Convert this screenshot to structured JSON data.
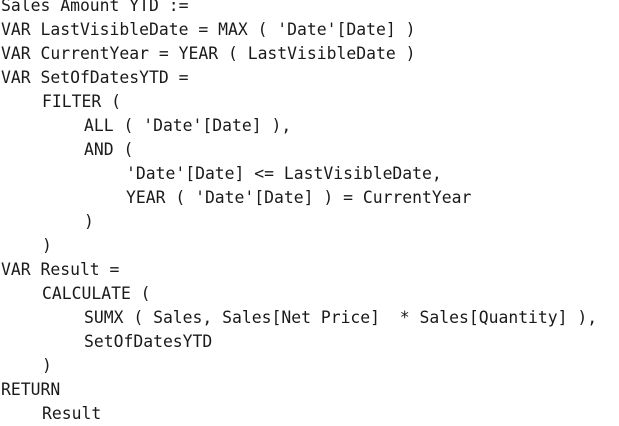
{
  "code": {
    "lines": [
      {
        "indent": 0,
        "text": "Sales Amount YTD :="
      },
      {
        "indent": 0,
        "text": "VAR LastVisibleDate = MAX ( 'Date'[Date] )"
      },
      {
        "indent": 0,
        "text": "VAR CurrentYear = YEAR ( LastVisibleDate )"
      },
      {
        "indent": 0,
        "text": "VAR SetOfDatesYTD ="
      },
      {
        "indent": 1,
        "text": "FILTER ("
      },
      {
        "indent": 2,
        "text": "ALL ( 'Date'[Date] ),"
      },
      {
        "indent": 2,
        "text": "AND ("
      },
      {
        "indent": 3,
        "text": "'Date'[Date] <= LastVisibleDate,"
      },
      {
        "indent": 3,
        "text": "YEAR ( 'Date'[Date] ) = CurrentYear"
      },
      {
        "indent": 2,
        "text": ")"
      },
      {
        "indent": 1,
        "text": ")"
      },
      {
        "indent": 0,
        "text": "VAR Result ="
      },
      {
        "indent": 1,
        "text": "CALCULATE ("
      },
      {
        "indent": 2,
        "text": "SUMX ( Sales, Sales[Net Price]  * Sales[Quantity] ),"
      },
      {
        "indent": 2,
        "text": "SetOfDatesYTD"
      },
      {
        "indent": 1,
        "text": ")"
      },
      {
        "indent": 0,
        "text": "RETURN"
      },
      {
        "indent": 1,
        "text": "Result"
      }
    ]
  }
}
